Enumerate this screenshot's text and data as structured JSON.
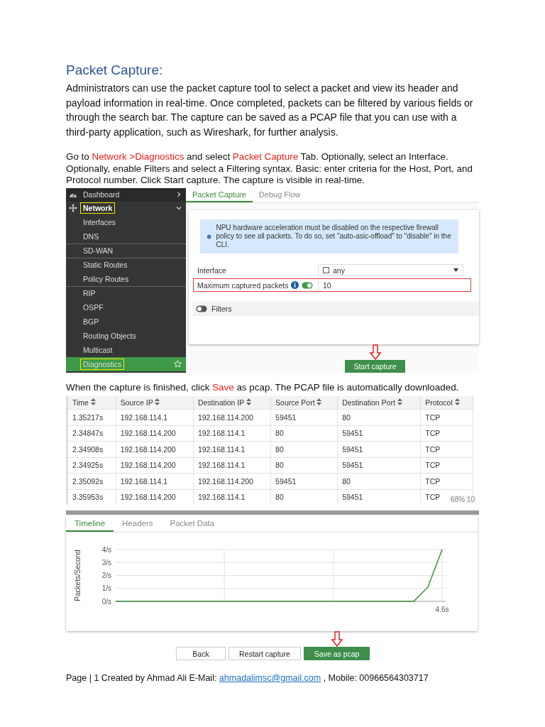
{
  "heading": "Packet Capture:",
  "paragraphs": [
    {
      "segments": [
        {
          "text": "Administrators can use the packet capture tool to select a packet and view its header and payload information in real-time. Once completed, packets can be filtered by various fields or through the search bar. The capture can be saved as a PCAP file that you can use with a third-party application, such as Wireshark, for further analysis.",
          "highlight": false
        }
      ]
    },
    {
      "segments": [
        {
          "text": "Go to ",
          "highlight": false
        },
        {
          "text": "Network >Diagnostics",
          "highlight": true
        },
        {
          "text": " and select ",
          "highlight": false
        },
        {
          "text": "Packet Capture",
          "highlight": true
        },
        {
          "text": " Tab. Optionally, select an Interface. Optionally, enable Filters and select a Filtering syntax. Basic: enter criteria for the Host, Port, and Protocol number. Click Start capture. The capture is visible in real-time.",
          "highlight": false
        }
      ]
    }
  ],
  "capture_screenshot": {
    "sidebar": {
      "items": [
        {
          "label": "Dashboard",
          "expanded": false,
          "highlighted": false
        },
        {
          "label": "Network",
          "expanded": true,
          "highlighted": true,
          "children": [
            {
              "label": "Interfaces",
              "divider_before": false,
              "selected": false,
              "highlighted": false
            },
            {
              "label": "DNS",
              "divider_before": false,
              "selected": false,
              "highlighted": false
            },
            {
              "label": "SD-WAN",
              "divider_before": true,
              "selected": false,
              "highlighted": false
            },
            {
              "label": "Static Routes",
              "divider_before": true,
              "selected": false,
              "highlighted": false
            },
            {
              "label": "Policy Routes",
              "divider_before": false,
              "selected": false,
              "highlighted": false
            },
            {
              "label": "RIP",
              "divider_before": true,
              "selected": false,
              "highlighted": false
            },
            {
              "label": "OSPF",
              "divider_before": false,
              "selected": false,
              "highlighted": false
            },
            {
              "label": "BGP",
              "divider_before": false,
              "selected": false,
              "highlighted": false
            },
            {
              "label": "Routing Objects",
              "divider_before": false,
              "selected": false,
              "highlighted": false
            },
            {
              "label": "Multicast",
              "divider_before": false,
              "selected": false,
              "highlighted": false
            },
            {
              "label": "Diagnostics",
              "divider_before": false,
              "selected": true,
              "highlighted": true
            }
          ]
        }
      ]
    },
    "tabs": [
      {
        "label": "Packet Capture",
        "selected": true
      },
      {
        "label": "Debug Flow",
        "selected": false
      }
    ],
    "notice": "NPU hardware acceleration must be disabled on the respective firewall policy to see all packets. To do so, set \"auto-asic-offload\" to \"disable\" in the CLI.",
    "interface": {
      "label": "Interface",
      "value": "any"
    },
    "max_packets": {
      "label": "Maximum captured packets",
      "on": true,
      "value": "10",
      "highlighted": true
    },
    "filters": {
      "label": "Filters",
      "on": false
    },
    "start_button": {
      "label": "Start capture",
      "pointed": true
    }
  },
  "instruction": {
    "segments": [
      {
        "text": "When the capture is finished, click ",
        "highlight": false
      },
      {
        "text": "Save",
        "highlight": true
      },
      {
        "text": " as pcap. The PCAP file is automatically downloaded.",
        "highlight": false
      }
    ]
  },
  "results_screenshot": {
    "table": {
      "columns": [
        "Time",
        "Source IP",
        "Destination IP",
        "Source Port",
        "Destination Port",
        "Protocol"
      ],
      "rows": [
        [
          "1.35217s",
          "192.168.114.1",
          "192.168.114.200",
          "59451",
          "80",
          "TCP"
        ],
        [
          "2.34847s",
          "192.168.114.200",
          "192.168.114.1",
          "80",
          "59451",
          "TCP"
        ],
        [
          "2.34908s",
          "192.168.114.200",
          "192.168.114.1",
          "80",
          "59451",
          "TCP"
        ],
        [
          "2.34925s",
          "192.168.114.200",
          "192.168.114.1",
          "80",
          "59451",
          "TCP"
        ],
        [
          "2.35092s",
          "192.168.114.1",
          "192.168.114.200",
          "59451",
          "80",
          "TCP"
        ],
        [
          "3.35953s",
          "192.168.114.200",
          "192.168.114.1",
          "80",
          "59451",
          "TCP"
        ]
      ],
      "overlay": "68% 10"
    },
    "tabs": [
      {
        "label": "Timeline",
        "selected": true
      },
      {
        "label": "Headers",
        "selected": false
      },
      {
        "label": "Packet Data",
        "selected": false
      }
    ],
    "chart_data": {
      "type": "line",
      "grid": true,
      "ylabel": "Packets/Second",
      "annotations": [
        {
          "text": "4.6s"
        }
      ],
      "ylim": [
        0,
        4
      ],
      "yticks": [
        {
          "value": 0,
          "label": "0/s"
        },
        {
          "value": 1,
          "label": "1/s"
        },
        {
          "value": 2,
          "label": "2/s"
        },
        {
          "value": 3,
          "label": "3/s"
        },
        {
          "value": 4,
          "label": "4/s"
        }
      ],
      "series": [
        {
          "color": "#3a8a3a",
          "values": [
            0,
            0,
            0,
            0,
            0,
            0,
            0,
            0,
            0,
            0,
            0,
            0,
            0,
            0,
            0,
            0,
            0,
            0,
            0,
            0,
            0,
            0,
            1.1,
            4
          ]
        }
      ]
    },
    "buttons": [
      {
        "label": "Back",
        "kind": "plain",
        "pointed": false
      },
      {
        "label": "Restart capture",
        "kind": "plain",
        "pointed": false
      },
      {
        "label": "Save as pcap",
        "kind": "primary",
        "pointed": true
      }
    ]
  },
  "footer": {
    "before": "Page | 1 Created by Ahmad Ali E-Mail: ",
    "link": "ahmadalimsc@gmail.com",
    "after": " , Mobile: 00966564303717"
  }
}
